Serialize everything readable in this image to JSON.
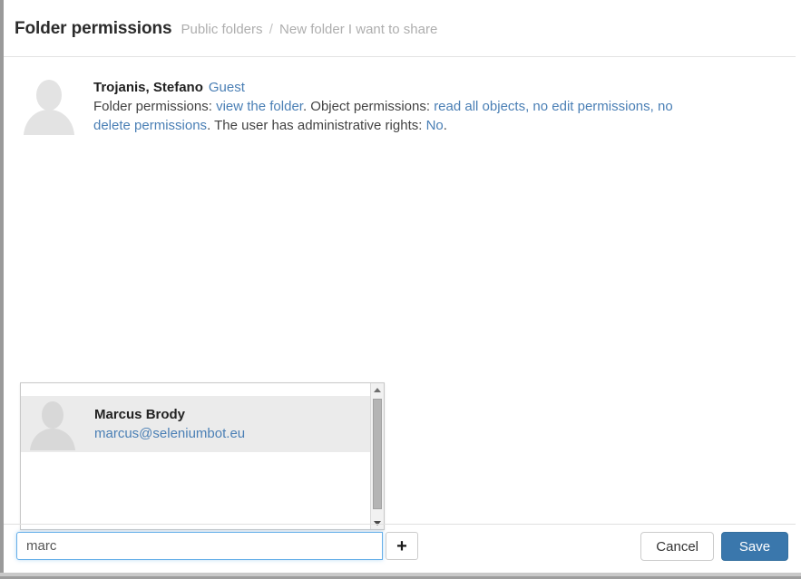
{
  "header": {
    "title": "Folder permissions",
    "breadcrumb": {
      "parent": "Public folders",
      "separator": "/",
      "current": "New folder I want to share"
    }
  },
  "entry": {
    "avatar_icon": "user-placeholder-icon",
    "name": "Trojanis, Stefano",
    "role": "Guest",
    "permissions": {
      "folder_label": "Folder permissions:",
      "folder_value": "view the folder",
      "folder_period": ".",
      "object_label": "Object permissions:",
      "object_values": "read all objects, no edit permissions, no delete permissions",
      "object_period": ".",
      "admin_label": "The user has administrative rights:",
      "admin_value": "No",
      "admin_period": "."
    }
  },
  "suggestions": {
    "items": [
      {
        "avatar_icon": "user-placeholder-icon",
        "name": "Marcus Brody",
        "email": "marcus@seleniumbot.eu",
        "selected": true
      }
    ],
    "scrollbar": {
      "up_icon": "triangle-up-icon",
      "down_icon": "triangle-down-icon"
    }
  },
  "footer": {
    "search_value": "marc",
    "search_placeholder": "",
    "add_label": "+",
    "cancel_label": "Cancel",
    "save_label": "Save"
  },
  "colors": {
    "link": "#4a7fb5",
    "save_button": "#3a77ac",
    "focus_border": "#66afe9",
    "row_selected": "#ebebeb",
    "breadcrumb": "#aeaeae"
  }
}
